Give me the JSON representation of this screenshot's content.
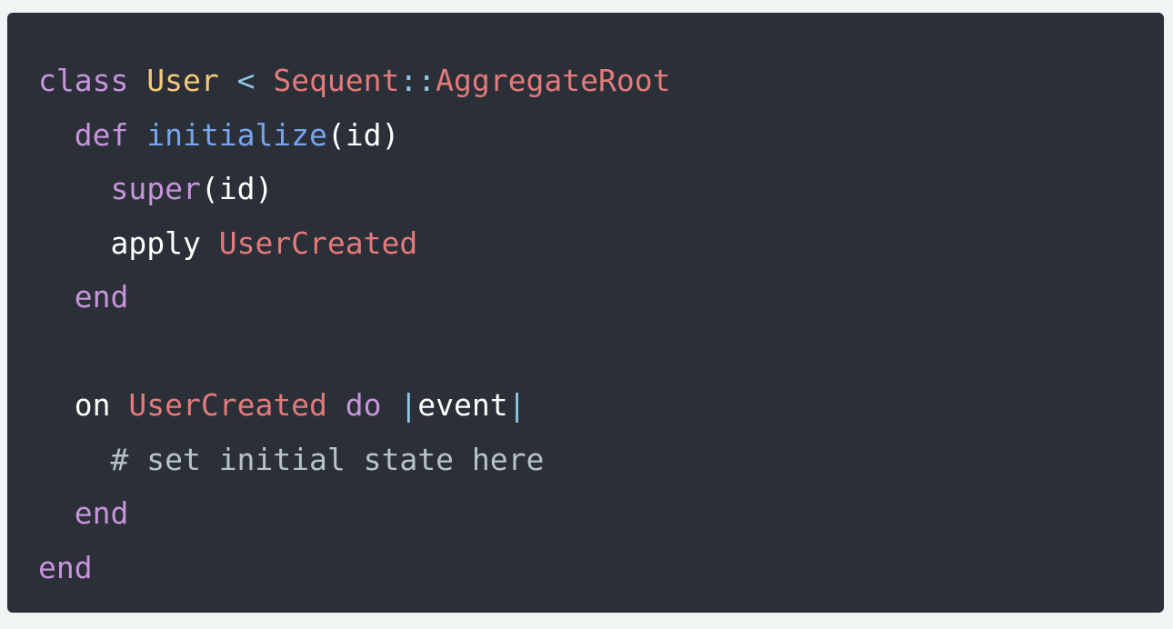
{
  "colors": {
    "background": "#f1f4f4",
    "code_background": "#2a2f38",
    "keyword": "#c894dc",
    "class_name": "#f6c97a",
    "constant": "#e47a7a",
    "operator": "#8fc8e6",
    "function": "#78a4ea",
    "plain": "#ffffff",
    "comment": "#b9c2cc"
  },
  "code": {
    "language": "ruby",
    "lines": [
      [
        {
          "text": "class",
          "kind": "keyword"
        },
        {
          "text": " ",
          "kind": "plain"
        },
        {
          "text": "User",
          "kind": "class_name"
        },
        {
          "text": " ",
          "kind": "plain"
        },
        {
          "text": "<",
          "kind": "operator"
        },
        {
          "text": " ",
          "kind": "plain"
        },
        {
          "text": "Sequent",
          "kind": "constant"
        },
        {
          "text": "::",
          "kind": "operator"
        },
        {
          "text": "AggregateRoot",
          "kind": "constant"
        }
      ],
      [
        {
          "text": "  ",
          "kind": "plain"
        },
        {
          "text": "def",
          "kind": "keyword"
        },
        {
          "text": " ",
          "kind": "plain"
        },
        {
          "text": "initialize",
          "kind": "function"
        },
        {
          "text": "(id)",
          "kind": "plain"
        }
      ],
      [
        {
          "text": "    ",
          "kind": "plain"
        },
        {
          "text": "super",
          "kind": "keyword"
        },
        {
          "text": "(id)",
          "kind": "plain"
        }
      ],
      [
        {
          "text": "    ",
          "kind": "plain"
        },
        {
          "text": "apply",
          "kind": "plain"
        },
        {
          "text": " ",
          "kind": "plain"
        },
        {
          "text": "UserCreated",
          "kind": "constant"
        }
      ],
      [
        {
          "text": "  ",
          "kind": "plain"
        },
        {
          "text": "end",
          "kind": "keyword"
        }
      ],
      [],
      [
        {
          "text": "  ",
          "kind": "plain"
        },
        {
          "text": "on",
          "kind": "plain"
        },
        {
          "text": " ",
          "kind": "plain"
        },
        {
          "text": "UserCreated",
          "kind": "constant"
        },
        {
          "text": " ",
          "kind": "plain"
        },
        {
          "text": "do",
          "kind": "keyword"
        },
        {
          "text": " ",
          "kind": "plain"
        },
        {
          "text": "|",
          "kind": "operator"
        },
        {
          "text": "event",
          "kind": "plain"
        },
        {
          "text": "|",
          "kind": "operator"
        }
      ],
      [
        {
          "text": "    ",
          "kind": "plain"
        },
        {
          "text": "# set initial state here",
          "kind": "comment"
        }
      ],
      [
        {
          "text": "  ",
          "kind": "plain"
        },
        {
          "text": "end",
          "kind": "keyword"
        }
      ],
      [
        {
          "text": "end",
          "kind": "keyword"
        }
      ]
    ]
  }
}
